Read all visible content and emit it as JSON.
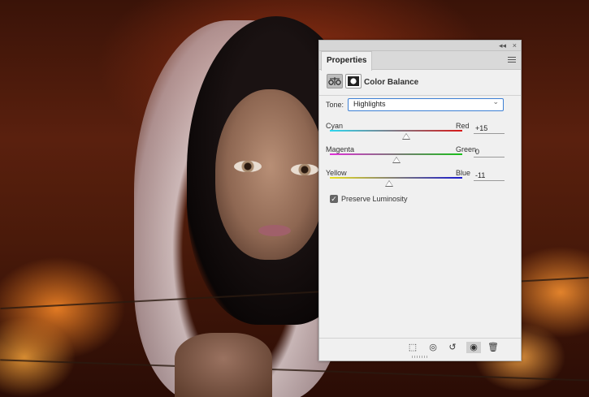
{
  "panel": {
    "tab_label": "Properties",
    "title": "Color Balance",
    "icons": {
      "adjustment": "color-balance-icon",
      "mask": "mask-icon",
      "menu": "panel-menu-icon",
      "collapse": "collapse-arrows-icon"
    },
    "titlebar_controls": {
      "collapse": "◂◂",
      "close": "×"
    }
  },
  "tone": {
    "label": "Tone:",
    "value": "Highlights"
  },
  "sliders": [
    {
      "left": "Cyan",
      "right": "Red",
      "value": "+15",
      "position": 0.575,
      "gradient": [
        "#2ed8f0",
        "#d81818"
      ]
    },
    {
      "left": "Magenta",
      "right": "Green",
      "value": "0",
      "position": 0.5,
      "gradient": [
        "#e030d8",
        "#18c018"
      ]
    },
    {
      "left": "Yellow",
      "right": "Blue",
      "value": "-11",
      "position": 0.445,
      "gradient": [
        "#e8e020",
        "#1818d0"
      ]
    }
  ],
  "preserve_luminosity": {
    "label": "Preserve Luminosity",
    "checked": true,
    "check_glyph": "✓"
  },
  "bottom_bar": [
    {
      "name": "clip-to-layer-button",
      "icon": "clip-icon",
      "glyph": "⬚"
    },
    {
      "name": "view-previous-button",
      "icon": "eye-previous-icon",
      "glyph": "◎"
    },
    {
      "name": "reset-button",
      "icon": "reset-icon",
      "glyph": "↺"
    },
    {
      "name": "toggle-visibility-button",
      "icon": "eye-icon",
      "glyph": "◉"
    },
    {
      "name": "delete-button",
      "icon": "trash-icon",
      "glyph": "🗑"
    }
  ]
}
